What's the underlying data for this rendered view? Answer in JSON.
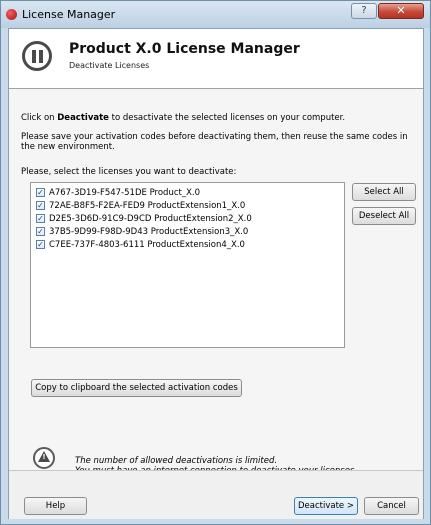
{
  "window": {
    "title": "License Manager",
    "help_glyph": "?",
    "close_glyph": "✕"
  },
  "header": {
    "title": "Product X.0 License Manager",
    "subtitle": "Deactivate Licenses"
  },
  "instructions": {
    "line1_prefix": "Click on ",
    "line1_bold": "Deactivate",
    "line1_suffix": " to desactivate the selected licenses on your computer.",
    "line2": "Please save your activation codes before deactivating them, then reuse the same codes in the new environment.",
    "line3": "Please, select the licenses you want to deactivate:"
  },
  "licenses": [
    {
      "code": "A767-3D19-F547-51DE",
      "product": "Product_X.0",
      "checked": true
    },
    {
      "code": "72AE-B8F5-F2EA-FED9",
      "product": "ProductExtension1_X.0",
      "checked": true
    },
    {
      "code": "D2E5-3D6D-91C9-D9CD",
      "product": "ProductExtension2_X.0",
      "checked": true
    },
    {
      "code": "37B5-9D99-F98D-9D43",
      "product": "ProductExtension3_X.0",
      "checked": true
    },
    {
      "code": "C7EE-737F-4803-6111",
      "product": "ProductExtension4_X.0",
      "checked": true
    }
  ],
  "buttons": {
    "select_all": "Select All",
    "deselect_all": "Deselect All",
    "copy": "Copy to clipboard the selected activation codes",
    "help": "Help",
    "deactivate": "Deactivate >",
    "cancel": "Cancel"
  },
  "warning": {
    "line1": "The number of allowed deactivations is limited.",
    "line2": "You must have an internet connection to deactivate your licenses."
  },
  "check_glyph": "✓",
  "icons": {
    "app": "red-circle-icon",
    "logo": "pause-circle-logo-icon",
    "warning": "warning-triangle-icon"
  }
}
